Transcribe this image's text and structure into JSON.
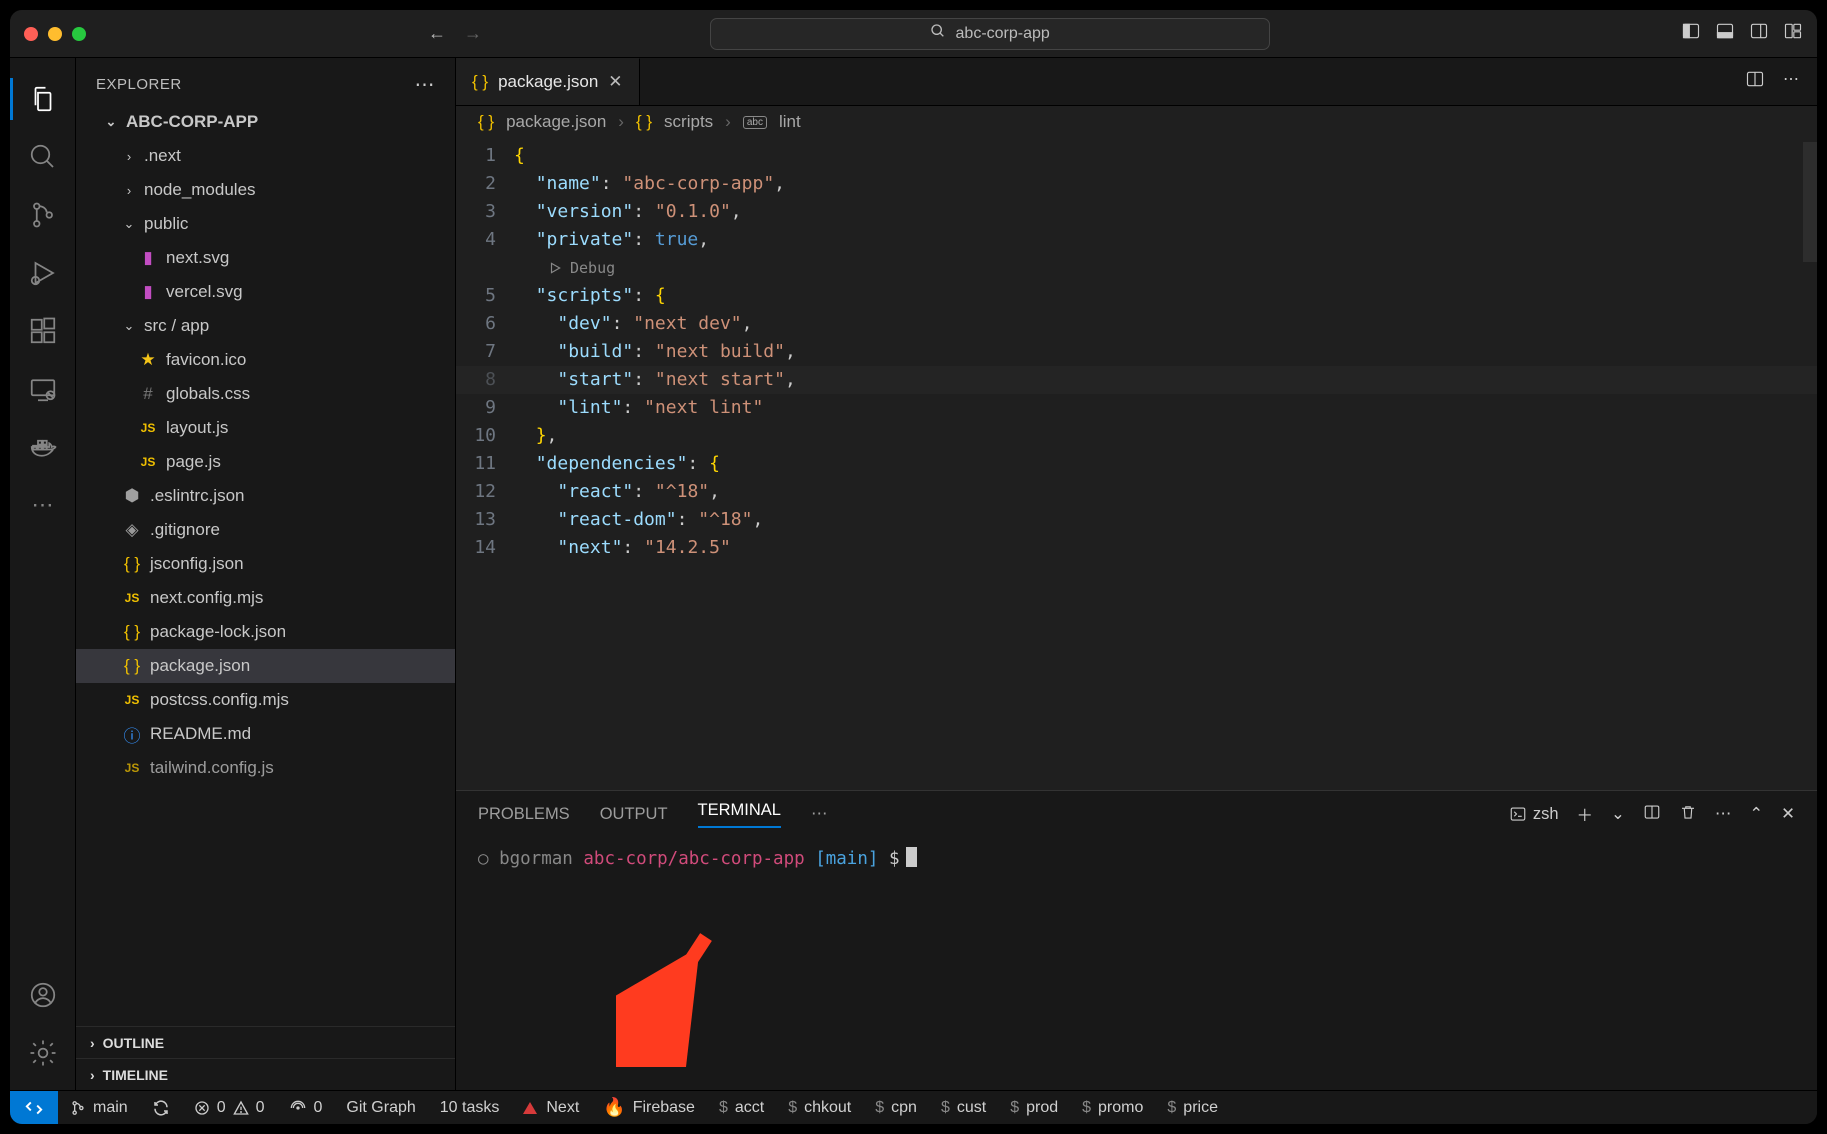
{
  "titlebar": {
    "search": "abc-corp-app"
  },
  "sidebar": {
    "title": "EXPLORER",
    "project": "ABC-CORP-APP",
    "tree": {
      "next": ".next",
      "node_modules": "node_modules",
      "public": "public",
      "public_items": [
        "next.svg",
        "vercel.svg"
      ],
      "srcapp": "src / app",
      "srcapp_items": [
        "favicon.ico",
        "globals.css",
        "layout.js",
        "page.js"
      ],
      "root_items": [
        ".eslintrc.json",
        ".gitignore",
        "jsconfig.json",
        "next.config.mjs",
        "package-lock.json",
        "package.json",
        "postcss.config.mjs",
        "README.md",
        "tailwind.config.js"
      ]
    },
    "outline": "OUTLINE",
    "timeline": "TIMELINE"
  },
  "tabs": {
    "active": "package.json"
  },
  "breadcrumb": {
    "file": "package.json",
    "seg2": "scripts",
    "seg3": "lint"
  },
  "code": {
    "debug": "Debug",
    "name_k": "name",
    "name_v": "abc-corp-app",
    "version_k": "version",
    "version_v": "0.1.0",
    "private_k": "private",
    "private_v": "true",
    "scripts_k": "scripts",
    "dev_k": "dev",
    "dev_v": "next dev",
    "build_k": "build",
    "build_v": "next build",
    "start_k": "start",
    "start_v": "next start",
    "lint_k": "lint",
    "lint_v": "next lint",
    "deps_k": "dependencies",
    "react_k": "react",
    "react_v": "^18",
    "reactdom_k": "react-dom",
    "reactdom_v": "^18",
    "next_k": "next",
    "next_v": "14.2.5"
  },
  "panel": {
    "tabs": {
      "problems": "PROBLEMS",
      "output": "OUTPUT",
      "terminal": "TERMINAL"
    },
    "shell": "zsh",
    "prompt": {
      "user": "bgorman",
      "repo": "abc-corp/abc-corp-app",
      "branch": "[main]",
      "sym": "$"
    }
  },
  "status": {
    "branch": "main",
    "sync": "",
    "errors": "0",
    "warnings": "0",
    "ports": "0",
    "gitgraph": "Git Graph",
    "tasks": "10 tasks",
    "next": "Next",
    "firebase": "Firebase",
    "acct": "acct",
    "chkout": "chkout",
    "cpn": "cpn",
    "cust": "cust",
    "prod": "prod",
    "promo": "promo",
    "price": "price"
  }
}
